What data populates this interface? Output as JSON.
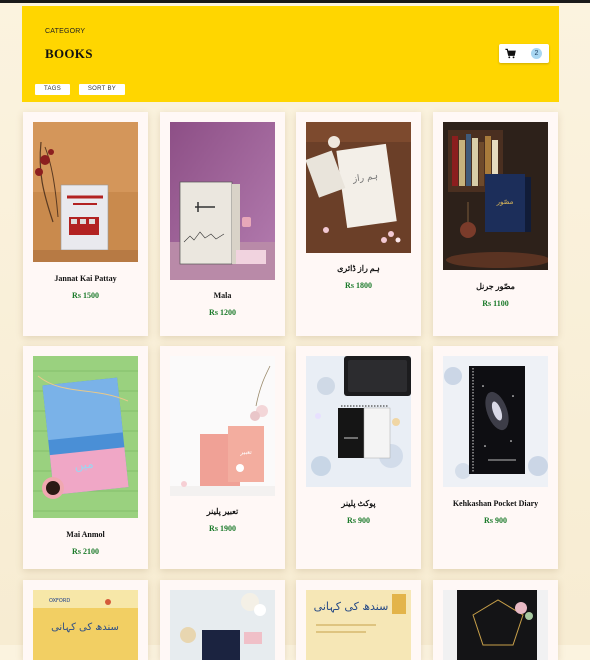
{
  "header": {
    "category_label": "CATEGORY",
    "title": "BOOKS",
    "cart_count": "2",
    "tags_label": "TAGS",
    "sort_label": "SORT BY"
  },
  "products": [
    {
      "name": "Jannat Kai Pattay",
      "price": "Rs 1500"
    },
    {
      "name": "Mala",
      "price": "Rs 1200"
    },
    {
      "name": "ہم راز ڈائری",
      "price": "Rs 1800"
    },
    {
      "name": "مصّور جرنل",
      "price": "Rs 1100"
    },
    {
      "name": "Mai Anmol",
      "price": "Rs 2100"
    },
    {
      "name": "تعبیر پلینر",
      "price": "Rs 1900"
    },
    {
      "name": "پوکٹ پلینر",
      "price": "Rs 900"
    },
    {
      "name": "Kehkashan Pocket Diary",
      "price": "Rs 900"
    }
  ],
  "colors": {
    "header_bg": "#ffd600",
    "price": "#1b7a2a",
    "card_bg": "#fff8f6"
  }
}
